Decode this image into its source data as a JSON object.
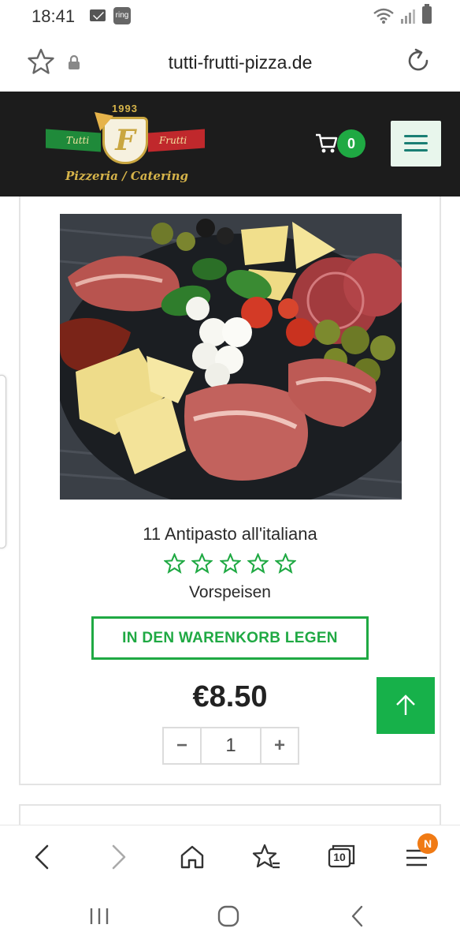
{
  "status_bar": {
    "time": "18:41",
    "ring_label": "ring"
  },
  "browser": {
    "url": "tutti-frutti-pizza.de",
    "tab_count": "10",
    "menu_badge": "N"
  },
  "header": {
    "logo": {
      "year": "1993",
      "left_ribbon": "Tutti",
      "right_ribbon": "Frutti",
      "letter": "F",
      "subtitle": "Pizzeria / Catering"
    },
    "cart_count": "0"
  },
  "product": {
    "image_alt": "Antipasto platter",
    "title": "11 Antipasto all'italiana",
    "rating_stars": 0,
    "rating_max": 5,
    "category": "Vorspeisen",
    "add_to_cart_label": "IN DEN WARENKORB LEGEN",
    "price": "€8.50",
    "quantity": "1",
    "qty_minus": "−",
    "qty_plus": "+"
  },
  "colors": {
    "accent_green": "#1fa943",
    "header_bg": "#1c1c1c",
    "badge_orange": "#f07a14"
  }
}
